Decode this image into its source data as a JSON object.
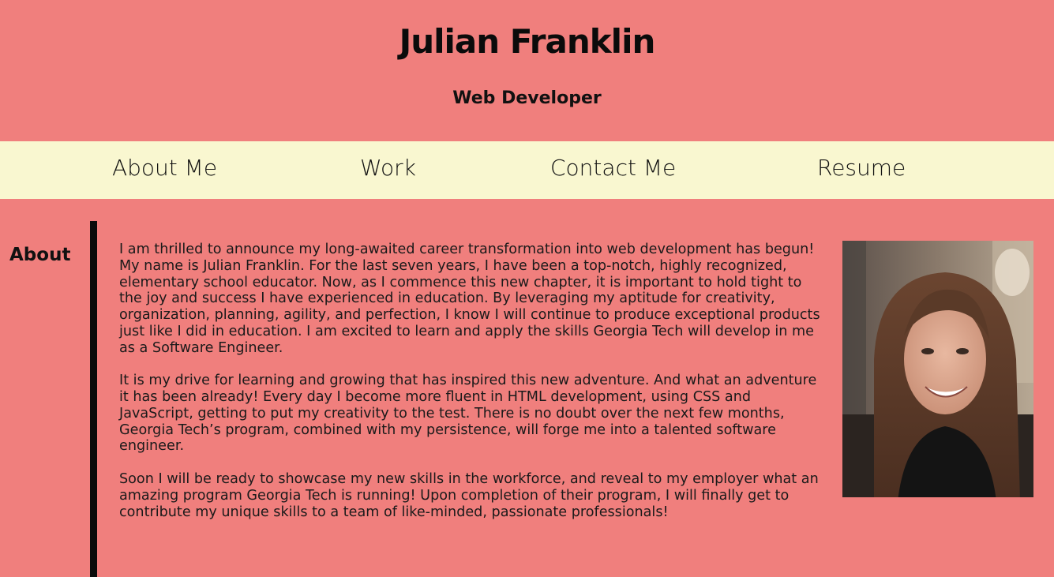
{
  "header": {
    "title": "Julian Franklin",
    "subtitle": "Web Developer"
  },
  "nav": {
    "items": [
      {
        "label": "About Me"
      },
      {
        "label": "Work"
      },
      {
        "label": "Contact Me"
      },
      {
        "label": "Resume"
      }
    ]
  },
  "about": {
    "heading": "About",
    "paragraphs": [
      "I am thrilled to announce my long-awaited career transformation into web development has begun! My name is Julian Franklin. For the last seven years, I have been a top-notch, highly recognized, elementary school educator. Now, as I commence this new chapter, it is important to hold tight to the joy and success I have experienced in education. By leveraging my aptitude for creativity, organization, planning, agility, and perfection, I know I will continue to produce exceptional products just like I did in education. I am excited to learn and apply the skills Georgia Tech will develop in me as a Software Engineer.",
      "It is my drive for learning and growing that has inspired this new adventure. And what an adventure it has been already! Every day I become more fluent in HTML development, using CSS and JavaScript, getting to put my creativity to the test. There is no doubt over the next few months, Georgia Tech’s program, combined with my persistence, will forge me into a talented software engineer.",
      "Soon I will be ready to showcase my new skills in the workforce, and reveal to my employer what an amazing program Georgia Tech is running! Upon completion of their program, I will finally get to contribute my unique skills to a team of like-minded, passionate professionals!"
    ]
  },
  "colors": {
    "background": "#f07f7d",
    "nav_background": "#f9f7d0",
    "accent_bar": "#0b0b0b"
  }
}
